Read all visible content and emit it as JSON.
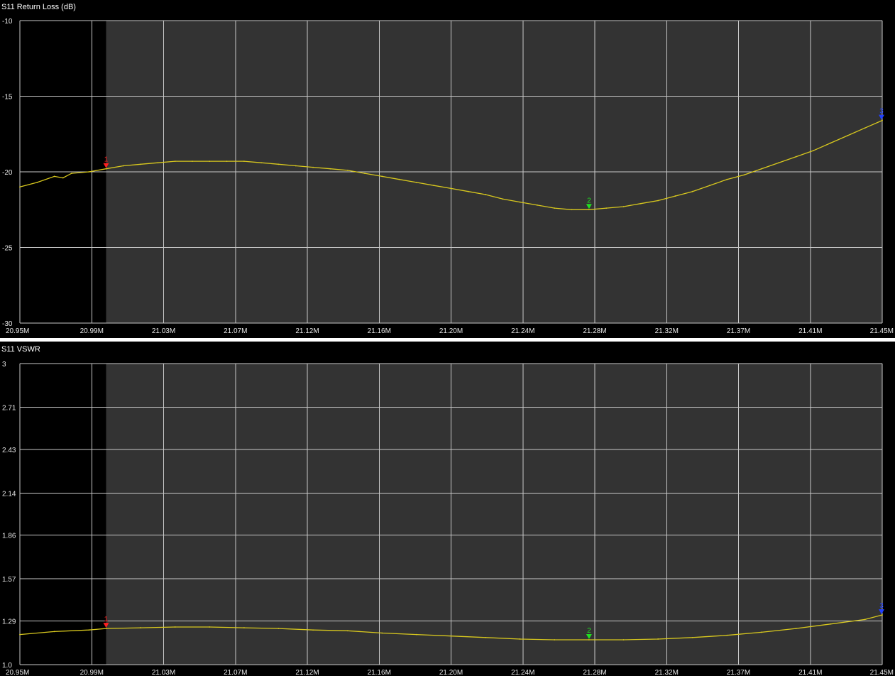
{
  "colors": {
    "background": "#000000",
    "plot_shaded": "#333333",
    "grid": "#c8c8c8",
    "trace": "#d8c81e",
    "separator": "#ffffff",
    "marker_1": "#ff2020",
    "marker_2": "#20e020",
    "marker_3": "#2040ff"
  },
  "chart_data": [
    {
      "type": "line",
      "title": "S11 Return Loss (dB)",
      "xlabel": "",
      "ylabel": "",
      "ylim": [
        -30,
        -10
      ],
      "yticks": [
        -10,
        -15,
        -20,
        -25,
        -30
      ],
      "ytick_labels": [
        "-10",
        "-15",
        "-20",
        "-25",
        "-30"
      ],
      "xlim": [
        20.95,
        21.45
      ],
      "xtick_labels": [
        "20.95M",
        "20.99M",
        "21.03M",
        "21.07M",
        "21.12M",
        "21.16M",
        "21.20M",
        "21.24M",
        "21.28M",
        "21.32M",
        "21.37M",
        "21.41M",
        "21.45M"
      ],
      "grid": true,
      "shaded_from_x": 21.0,
      "series": [
        {
          "x": [
            20.95,
            20.96,
            20.97,
            20.975,
            20.98,
            20.99,
            21.0,
            21.01,
            21.02,
            21.03,
            21.04,
            21.05,
            21.06,
            21.07,
            21.08,
            21.09,
            21.1,
            21.11,
            21.12,
            21.13,
            21.14,
            21.15,
            21.16,
            21.17,
            21.18,
            21.19,
            21.2,
            21.21,
            21.22,
            21.23,
            21.24,
            21.25,
            21.26,
            21.27,
            21.28,
            21.29,
            21.3,
            21.31,
            21.32,
            21.33,
            21.34,
            21.35,
            21.36,
            21.37,
            21.38,
            21.39,
            21.4,
            21.41,
            21.42,
            21.43,
            21.44,
            21.45
          ],
          "values": [
            -21.0,
            -20.7,
            -20.3,
            -20.4,
            -20.1,
            -20.0,
            -19.8,
            -19.6,
            -19.5,
            -19.4,
            -19.3,
            -19.3,
            -19.3,
            -19.3,
            -19.3,
            -19.4,
            -19.5,
            -19.6,
            -19.7,
            -19.8,
            -19.9,
            -20.1,
            -20.3,
            -20.5,
            -20.7,
            -20.9,
            -21.1,
            -21.3,
            -21.5,
            -21.8,
            -22.0,
            -22.2,
            -22.4,
            -22.5,
            -22.5,
            -22.4,
            -22.3,
            -22.1,
            -21.9,
            -21.6,
            -21.3,
            -20.9,
            -20.5,
            -20.2,
            -19.8,
            -19.4,
            -19.0,
            -18.6,
            -18.1,
            -17.6,
            -17.1,
            -16.6
          ]
        }
      ],
      "markers": [
        {
          "label": "1",
          "x": 21.0,
          "y": -19.8,
          "color": "#ff2020"
        },
        {
          "label": "2",
          "x": 21.28,
          "y": -22.5,
          "color": "#20e020"
        },
        {
          "label": "3",
          "x": 21.45,
          "y": -16.6,
          "color": "#2040ff"
        }
      ]
    },
    {
      "type": "line",
      "title": "S11 VSWR",
      "xlabel": "",
      "ylabel": "",
      "ylim": [
        1.0,
        3.0
      ],
      "yticks": [
        3.0,
        2.71,
        2.43,
        2.14,
        1.86,
        1.57,
        1.29,
        1.0
      ],
      "ytick_labels": [
        "3",
        "2.71",
        "2.43",
        "2.14",
        "1.86",
        "1.57",
        "1.29",
        "1.0"
      ],
      "xlim": [
        20.95,
        21.45
      ],
      "xtick_labels": [
        "20.95M",
        "20.99M",
        "21.03M",
        "21.07M",
        "21.12M",
        "21.16M",
        "21.20M",
        "21.24M",
        "21.28M",
        "21.32M",
        "21.37M",
        "21.41M",
        "21.45M"
      ],
      "grid": true,
      "shaded_from_x": 21.0,
      "series": [
        {
          "x": [
            20.95,
            20.97,
            20.99,
            21.0,
            21.02,
            21.04,
            21.06,
            21.08,
            21.1,
            21.12,
            21.14,
            21.16,
            21.18,
            21.2,
            21.22,
            21.24,
            21.26,
            21.28,
            21.3,
            21.32,
            21.34,
            21.36,
            21.38,
            21.4,
            21.42,
            21.44,
            21.45
          ],
          "values": [
            1.2,
            1.22,
            1.23,
            1.24,
            1.245,
            1.25,
            1.25,
            1.245,
            1.24,
            1.23,
            1.225,
            1.21,
            1.2,
            1.19,
            1.18,
            1.17,
            1.165,
            1.165,
            1.165,
            1.17,
            1.18,
            1.195,
            1.215,
            1.24,
            1.27,
            1.3,
            1.33
          ]
        }
      ],
      "markers": [
        {
          "label": "1",
          "x": 21.0,
          "y": 1.24,
          "color": "#ff2020"
        },
        {
          "label": "2",
          "x": 21.28,
          "y": 1.165,
          "color": "#20e020"
        },
        {
          "label": "3",
          "x": 21.45,
          "y": 1.33,
          "color": "#2040ff"
        }
      ]
    }
  ]
}
